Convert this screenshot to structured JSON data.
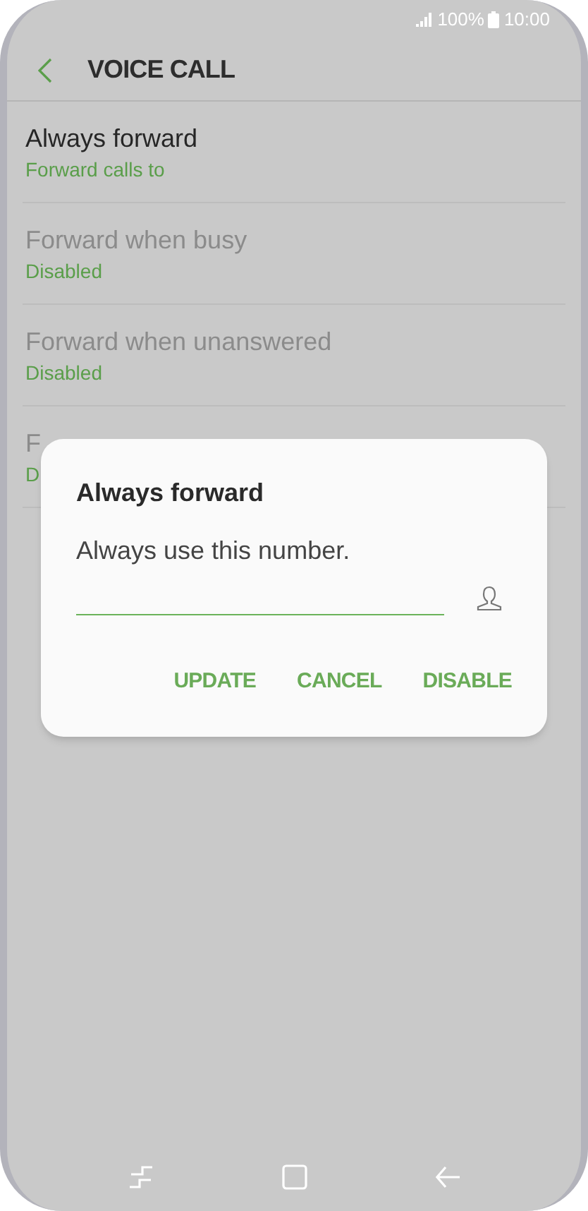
{
  "status_bar": {
    "battery": "100%",
    "time": "10:00"
  },
  "header": {
    "title": "VOICE CALL"
  },
  "items": [
    {
      "title": "Always forward",
      "subtitle": "Forward calls to",
      "disabled": false
    },
    {
      "title": "Forward when busy",
      "subtitle": "Disabled",
      "disabled": true
    },
    {
      "title": "Forward when unanswered",
      "subtitle": "Disabled",
      "disabled": true
    },
    {
      "title": "F",
      "subtitle": "D",
      "disabled": true
    }
  ],
  "dialog": {
    "title": "Always forward",
    "message": "Always use this number.",
    "buttons": [
      "UPDATE",
      "CANCEL",
      "DISABLE"
    ]
  }
}
